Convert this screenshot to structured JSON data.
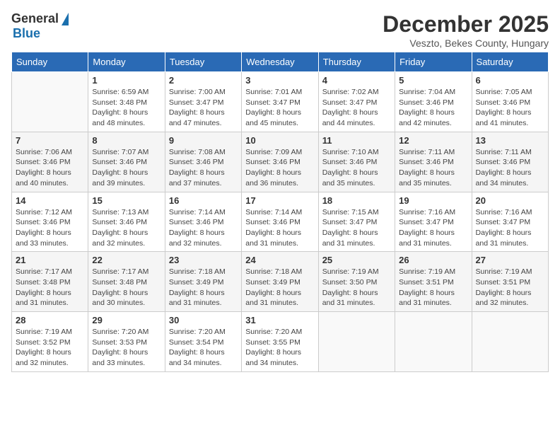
{
  "header": {
    "logo_general": "General",
    "logo_blue": "Blue",
    "month_title": "December 2025",
    "subtitle": "Veszto, Bekes County, Hungary"
  },
  "days_of_week": [
    "Sunday",
    "Monday",
    "Tuesday",
    "Wednesday",
    "Thursday",
    "Friday",
    "Saturday"
  ],
  "weeks": [
    [
      {
        "day": "",
        "info": ""
      },
      {
        "day": "1",
        "info": "Sunrise: 6:59 AM\nSunset: 3:48 PM\nDaylight: 8 hours\nand 48 minutes."
      },
      {
        "day": "2",
        "info": "Sunrise: 7:00 AM\nSunset: 3:47 PM\nDaylight: 8 hours\nand 47 minutes."
      },
      {
        "day": "3",
        "info": "Sunrise: 7:01 AM\nSunset: 3:47 PM\nDaylight: 8 hours\nand 45 minutes."
      },
      {
        "day": "4",
        "info": "Sunrise: 7:02 AM\nSunset: 3:47 PM\nDaylight: 8 hours\nand 44 minutes."
      },
      {
        "day": "5",
        "info": "Sunrise: 7:04 AM\nSunset: 3:46 PM\nDaylight: 8 hours\nand 42 minutes."
      },
      {
        "day": "6",
        "info": "Sunrise: 7:05 AM\nSunset: 3:46 PM\nDaylight: 8 hours\nand 41 minutes."
      }
    ],
    [
      {
        "day": "7",
        "info": "Sunrise: 7:06 AM\nSunset: 3:46 PM\nDaylight: 8 hours\nand 40 minutes."
      },
      {
        "day": "8",
        "info": "Sunrise: 7:07 AM\nSunset: 3:46 PM\nDaylight: 8 hours\nand 39 minutes."
      },
      {
        "day": "9",
        "info": "Sunrise: 7:08 AM\nSunset: 3:46 PM\nDaylight: 8 hours\nand 37 minutes."
      },
      {
        "day": "10",
        "info": "Sunrise: 7:09 AM\nSunset: 3:46 PM\nDaylight: 8 hours\nand 36 minutes."
      },
      {
        "day": "11",
        "info": "Sunrise: 7:10 AM\nSunset: 3:46 PM\nDaylight: 8 hours\nand 35 minutes."
      },
      {
        "day": "12",
        "info": "Sunrise: 7:11 AM\nSunset: 3:46 PM\nDaylight: 8 hours\nand 35 minutes."
      },
      {
        "day": "13",
        "info": "Sunrise: 7:11 AM\nSunset: 3:46 PM\nDaylight: 8 hours\nand 34 minutes."
      }
    ],
    [
      {
        "day": "14",
        "info": "Sunrise: 7:12 AM\nSunset: 3:46 PM\nDaylight: 8 hours\nand 33 minutes."
      },
      {
        "day": "15",
        "info": "Sunrise: 7:13 AM\nSunset: 3:46 PM\nDaylight: 8 hours\nand 32 minutes."
      },
      {
        "day": "16",
        "info": "Sunrise: 7:14 AM\nSunset: 3:46 PM\nDaylight: 8 hours\nand 32 minutes."
      },
      {
        "day": "17",
        "info": "Sunrise: 7:14 AM\nSunset: 3:46 PM\nDaylight: 8 hours\nand 31 minutes."
      },
      {
        "day": "18",
        "info": "Sunrise: 7:15 AM\nSunset: 3:47 PM\nDaylight: 8 hours\nand 31 minutes."
      },
      {
        "day": "19",
        "info": "Sunrise: 7:16 AM\nSunset: 3:47 PM\nDaylight: 8 hours\nand 31 minutes."
      },
      {
        "day": "20",
        "info": "Sunrise: 7:16 AM\nSunset: 3:47 PM\nDaylight: 8 hours\nand 31 minutes."
      }
    ],
    [
      {
        "day": "21",
        "info": "Sunrise: 7:17 AM\nSunset: 3:48 PM\nDaylight: 8 hours\nand 31 minutes."
      },
      {
        "day": "22",
        "info": "Sunrise: 7:17 AM\nSunset: 3:48 PM\nDaylight: 8 hours\nand 30 minutes."
      },
      {
        "day": "23",
        "info": "Sunrise: 7:18 AM\nSunset: 3:49 PM\nDaylight: 8 hours\nand 31 minutes."
      },
      {
        "day": "24",
        "info": "Sunrise: 7:18 AM\nSunset: 3:49 PM\nDaylight: 8 hours\nand 31 minutes."
      },
      {
        "day": "25",
        "info": "Sunrise: 7:19 AM\nSunset: 3:50 PM\nDaylight: 8 hours\nand 31 minutes."
      },
      {
        "day": "26",
        "info": "Sunrise: 7:19 AM\nSunset: 3:51 PM\nDaylight: 8 hours\nand 31 minutes."
      },
      {
        "day": "27",
        "info": "Sunrise: 7:19 AM\nSunset: 3:51 PM\nDaylight: 8 hours\nand 32 minutes."
      }
    ],
    [
      {
        "day": "28",
        "info": "Sunrise: 7:19 AM\nSunset: 3:52 PM\nDaylight: 8 hours\nand 32 minutes."
      },
      {
        "day": "29",
        "info": "Sunrise: 7:20 AM\nSunset: 3:53 PM\nDaylight: 8 hours\nand 33 minutes."
      },
      {
        "day": "30",
        "info": "Sunrise: 7:20 AM\nSunset: 3:54 PM\nDaylight: 8 hours\nand 34 minutes."
      },
      {
        "day": "31",
        "info": "Sunrise: 7:20 AM\nSunset: 3:55 PM\nDaylight: 8 hours\nand 34 minutes."
      },
      {
        "day": "",
        "info": ""
      },
      {
        "day": "",
        "info": ""
      },
      {
        "day": "",
        "info": ""
      }
    ]
  ]
}
